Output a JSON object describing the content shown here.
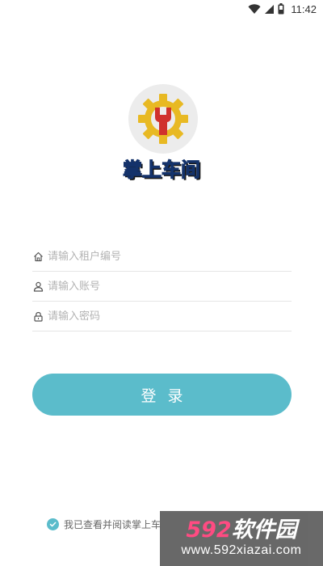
{
  "status_bar": {
    "time": "11:42",
    "icons": [
      "wifi-icon",
      "signal-icon",
      "battery-icon"
    ]
  },
  "app": {
    "name": "掌上车间",
    "logo_icon": "gear-wrench-logo",
    "colors": {
      "gear": "#e8b923",
      "wrench": "#d0312d",
      "title": "#2a66c4"
    }
  },
  "form": {
    "tenant": {
      "placeholder": "请输入租户编号",
      "value": "",
      "icon": "home-icon"
    },
    "account": {
      "placeholder": "请输入账号",
      "value": "",
      "icon": "user-icon"
    },
    "password": {
      "placeholder": "请输入密码",
      "value": "",
      "icon": "lock-icon"
    }
  },
  "login_button": {
    "label": "登录",
    "color": "#5bbccb"
  },
  "agreement": {
    "checked": true,
    "text": "我已查看并阅读掌上车"
  },
  "watermark": {
    "brand_number": "592",
    "brand_text": "软件园",
    "url": "www.592xiazai.com"
  }
}
